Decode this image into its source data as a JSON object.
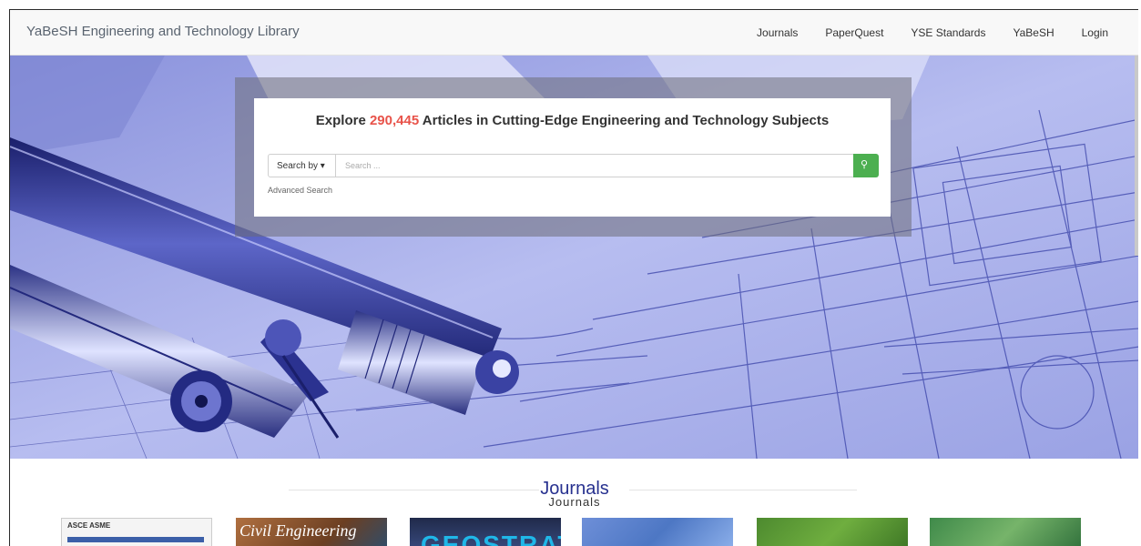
{
  "brand": "YaBeSH Engineering and Technology Library",
  "nav": {
    "items": [
      "Journals",
      "PaperQuest",
      "YSE Standards",
      "YaBeSH",
      "Login"
    ]
  },
  "hero": {
    "headline_prefix": "Explore ",
    "article_count": "290,445",
    "headline_suffix": " Articles in Cutting-Edge Engineering and Technology Subjects",
    "search_by_label": "Search by ▾",
    "search_placeholder": "Search ...",
    "advanced_search": "Advanced Search"
  },
  "journals": {
    "title": "Journals",
    "subtitle": "Journals",
    "covers": [
      {
        "label": "ASCE ASME"
      },
      {
        "label": "Civil Engineering"
      },
      {
        "label": "GEOSTRATA"
      },
      {
        "label": ""
      },
      {
        "label": ""
      },
      {
        "label": ""
      }
    ]
  },
  "colors": {
    "accent_count": "#e8534a",
    "search_button": "#4caf50",
    "journals_title": "#27318f",
    "hero_tint": "#6f78cf"
  },
  "icons": {
    "search_button": "search-icon"
  }
}
